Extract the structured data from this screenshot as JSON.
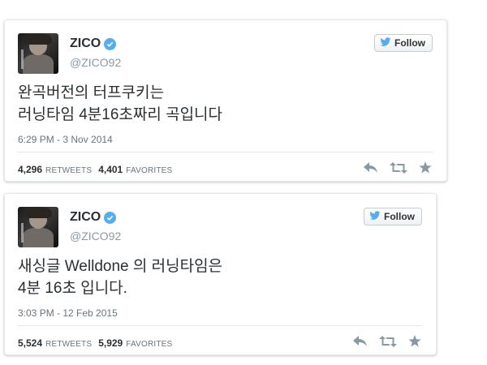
{
  "follow_label": "Follow",
  "tweets": [
    {
      "name": "ZICO",
      "handle": "@ZICO92",
      "text_lines": [
        "완곡버전의 터프쿠키는",
        "러닝타임 4분16초짜리 곡입니다"
      ],
      "timestamp": "6:29 PM - 3 Nov 2014",
      "retweets": "4,296",
      "retweets_label": "RETWEETS",
      "favorites": "4,401",
      "favorites_label": "FAVORITES"
    },
    {
      "name": "ZICO",
      "handle": "@ZICO92",
      "text_lines": [
        "새싱글 Welldone 의 러닝타임은",
        "4분 16초 입니다."
      ],
      "timestamp": "3:03 PM - 12 Feb 2015",
      "retweets": "5,524",
      "retweets_label": "RETWEETS",
      "favorites": "5,929",
      "favorites_label": "FAVORITES"
    }
  ],
  "icons": {
    "verified": "verified-badge-icon",
    "bird": "twitter-bird-icon",
    "reply": "reply-icon",
    "retweet": "retweet-icon",
    "favorite": "star-icon"
  },
  "colors": {
    "twitter_blue": "#55acee",
    "text": "#292f33",
    "muted": "#8899a6",
    "action_icons": "#8899a6"
  }
}
